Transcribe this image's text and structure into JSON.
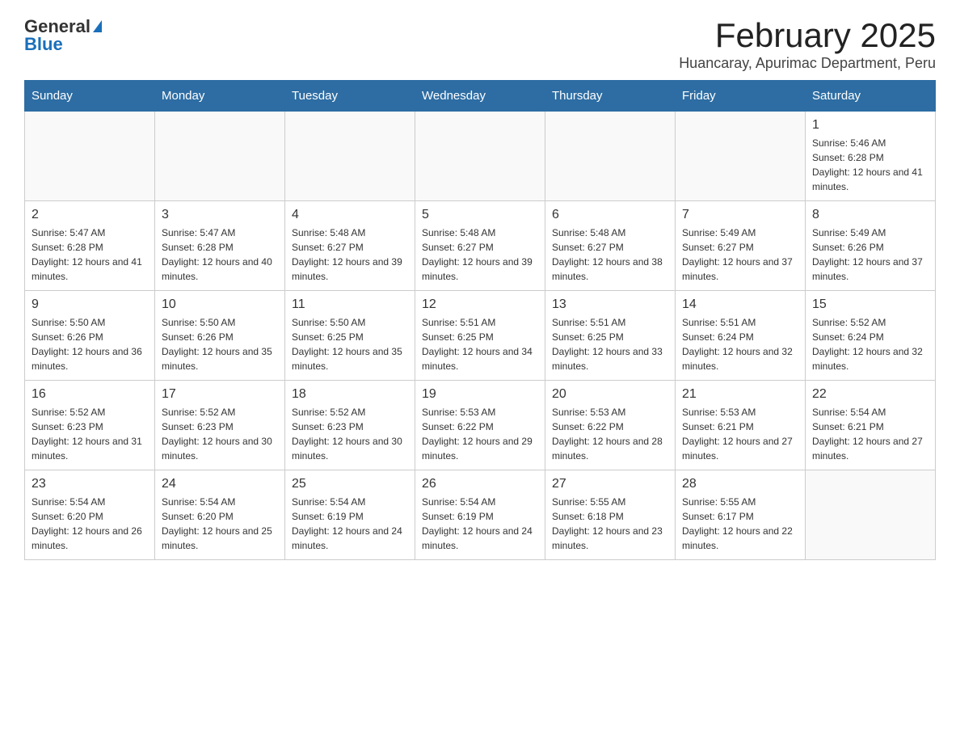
{
  "logo": {
    "general": "General",
    "blue": "Blue"
  },
  "title": "February 2025",
  "subtitle": "Huancaray, Apurimac Department, Peru",
  "days": [
    "Sunday",
    "Monday",
    "Tuesday",
    "Wednesday",
    "Thursday",
    "Friday",
    "Saturday"
  ],
  "weeks": [
    [
      {
        "num": "",
        "info": ""
      },
      {
        "num": "",
        "info": ""
      },
      {
        "num": "",
        "info": ""
      },
      {
        "num": "",
        "info": ""
      },
      {
        "num": "",
        "info": ""
      },
      {
        "num": "",
        "info": ""
      },
      {
        "num": "1",
        "info": "Sunrise: 5:46 AM\nSunset: 6:28 PM\nDaylight: 12 hours and 41 minutes."
      }
    ],
    [
      {
        "num": "2",
        "info": "Sunrise: 5:47 AM\nSunset: 6:28 PM\nDaylight: 12 hours and 41 minutes."
      },
      {
        "num": "3",
        "info": "Sunrise: 5:47 AM\nSunset: 6:28 PM\nDaylight: 12 hours and 40 minutes."
      },
      {
        "num": "4",
        "info": "Sunrise: 5:48 AM\nSunset: 6:27 PM\nDaylight: 12 hours and 39 minutes."
      },
      {
        "num": "5",
        "info": "Sunrise: 5:48 AM\nSunset: 6:27 PM\nDaylight: 12 hours and 39 minutes."
      },
      {
        "num": "6",
        "info": "Sunrise: 5:48 AM\nSunset: 6:27 PM\nDaylight: 12 hours and 38 minutes."
      },
      {
        "num": "7",
        "info": "Sunrise: 5:49 AM\nSunset: 6:27 PM\nDaylight: 12 hours and 37 minutes."
      },
      {
        "num": "8",
        "info": "Sunrise: 5:49 AM\nSunset: 6:26 PM\nDaylight: 12 hours and 37 minutes."
      }
    ],
    [
      {
        "num": "9",
        "info": "Sunrise: 5:50 AM\nSunset: 6:26 PM\nDaylight: 12 hours and 36 minutes."
      },
      {
        "num": "10",
        "info": "Sunrise: 5:50 AM\nSunset: 6:26 PM\nDaylight: 12 hours and 35 minutes."
      },
      {
        "num": "11",
        "info": "Sunrise: 5:50 AM\nSunset: 6:25 PM\nDaylight: 12 hours and 35 minutes."
      },
      {
        "num": "12",
        "info": "Sunrise: 5:51 AM\nSunset: 6:25 PM\nDaylight: 12 hours and 34 minutes."
      },
      {
        "num": "13",
        "info": "Sunrise: 5:51 AM\nSunset: 6:25 PM\nDaylight: 12 hours and 33 minutes."
      },
      {
        "num": "14",
        "info": "Sunrise: 5:51 AM\nSunset: 6:24 PM\nDaylight: 12 hours and 32 minutes."
      },
      {
        "num": "15",
        "info": "Sunrise: 5:52 AM\nSunset: 6:24 PM\nDaylight: 12 hours and 32 minutes."
      }
    ],
    [
      {
        "num": "16",
        "info": "Sunrise: 5:52 AM\nSunset: 6:23 PM\nDaylight: 12 hours and 31 minutes."
      },
      {
        "num": "17",
        "info": "Sunrise: 5:52 AM\nSunset: 6:23 PM\nDaylight: 12 hours and 30 minutes."
      },
      {
        "num": "18",
        "info": "Sunrise: 5:52 AM\nSunset: 6:23 PM\nDaylight: 12 hours and 30 minutes."
      },
      {
        "num": "19",
        "info": "Sunrise: 5:53 AM\nSunset: 6:22 PM\nDaylight: 12 hours and 29 minutes."
      },
      {
        "num": "20",
        "info": "Sunrise: 5:53 AM\nSunset: 6:22 PM\nDaylight: 12 hours and 28 minutes."
      },
      {
        "num": "21",
        "info": "Sunrise: 5:53 AM\nSunset: 6:21 PM\nDaylight: 12 hours and 27 minutes."
      },
      {
        "num": "22",
        "info": "Sunrise: 5:54 AM\nSunset: 6:21 PM\nDaylight: 12 hours and 27 minutes."
      }
    ],
    [
      {
        "num": "23",
        "info": "Sunrise: 5:54 AM\nSunset: 6:20 PM\nDaylight: 12 hours and 26 minutes."
      },
      {
        "num": "24",
        "info": "Sunrise: 5:54 AM\nSunset: 6:20 PM\nDaylight: 12 hours and 25 minutes."
      },
      {
        "num": "25",
        "info": "Sunrise: 5:54 AM\nSunset: 6:19 PM\nDaylight: 12 hours and 24 minutes."
      },
      {
        "num": "26",
        "info": "Sunrise: 5:54 AM\nSunset: 6:19 PM\nDaylight: 12 hours and 24 minutes."
      },
      {
        "num": "27",
        "info": "Sunrise: 5:55 AM\nSunset: 6:18 PM\nDaylight: 12 hours and 23 minutes."
      },
      {
        "num": "28",
        "info": "Sunrise: 5:55 AM\nSunset: 6:17 PM\nDaylight: 12 hours and 22 minutes."
      },
      {
        "num": "",
        "info": ""
      }
    ]
  ]
}
